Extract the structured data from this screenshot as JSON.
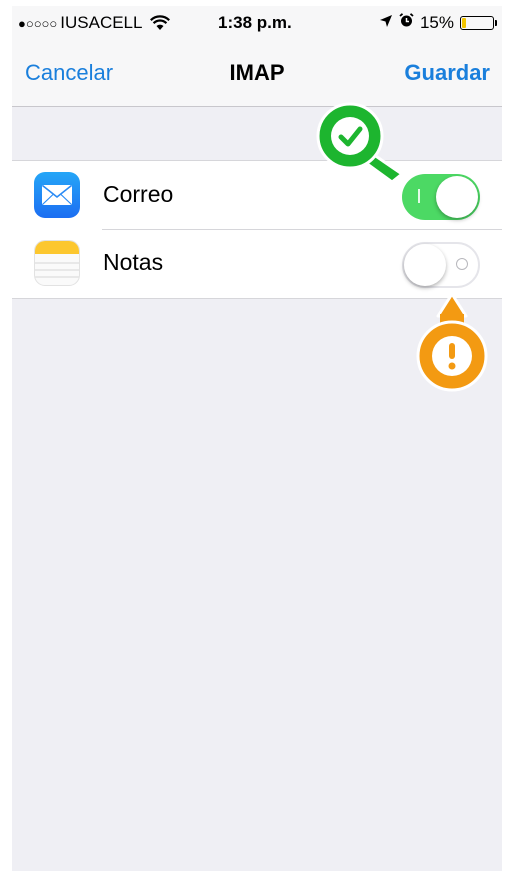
{
  "status_bar": {
    "signal": "●○○○○",
    "carrier": "IUSACELL",
    "time": "1:38 p.m.",
    "battery_percent": "15%",
    "battery_level": 0.15,
    "icons": [
      "wifi-icon",
      "location-arrow-icon",
      "alarm-clock-icon",
      "battery-icon"
    ]
  },
  "nav": {
    "cancel_label": "Cancelar",
    "title": "IMAP",
    "save_label": "Guardar"
  },
  "settings": {
    "items": [
      {
        "label": "Correo",
        "icon": "mail-app-icon",
        "enabled": true
      },
      {
        "label": "Notas",
        "icon": "notes-app-icon",
        "enabled": false
      }
    ]
  },
  "annotations": [
    {
      "icon": "checkmark-callout-icon",
      "color": "#1db52f"
    },
    {
      "icon": "exclamation-callout-icon",
      "color": "#f39a12"
    }
  ],
  "colors": {
    "accent": "#1a7fdc",
    "toggle_on": "#4cd964",
    "background": "#efeff4"
  }
}
